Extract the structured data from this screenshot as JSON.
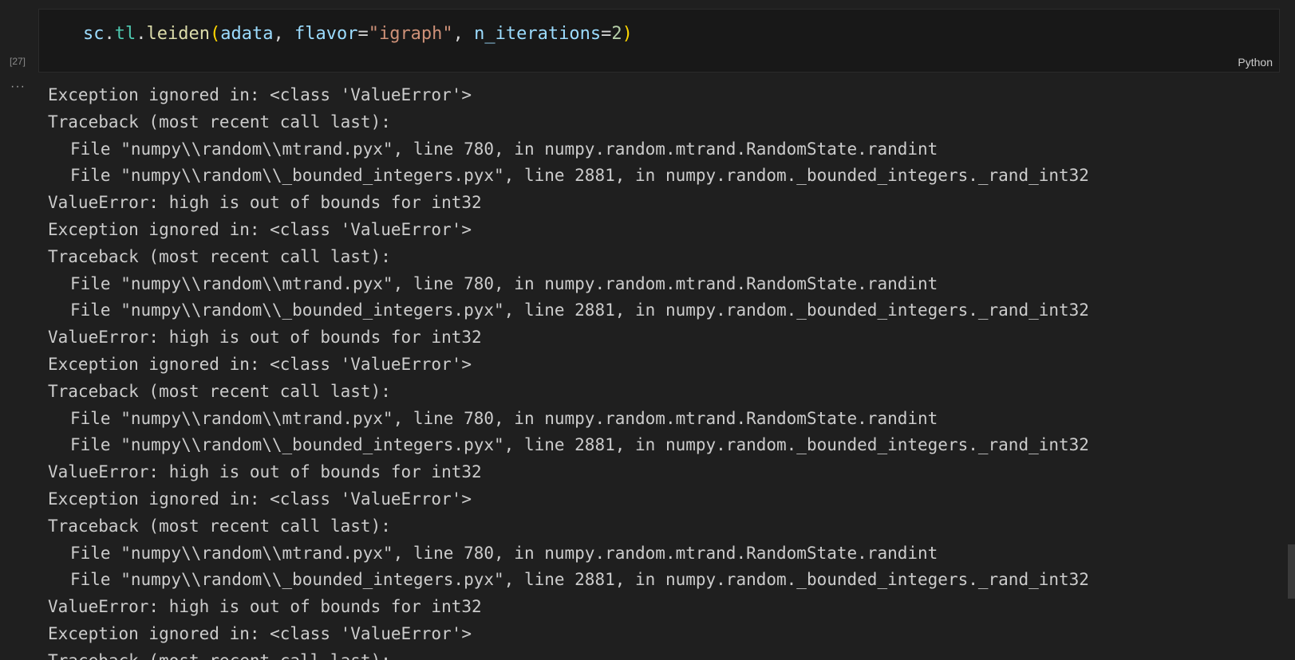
{
  "cell": {
    "execution_count": "[27]",
    "language": "Python",
    "code": {
      "t1": "sc",
      "t2": ".",
      "t3": "tl",
      "t4": ".",
      "t5": "leiden",
      "t6": "(",
      "t7": "adata",
      "t8": ", ",
      "t9": "flavor",
      "t10": "=",
      "t11": "\"igraph\"",
      "t12": ", ",
      "t13": "n_iterations",
      "t14": "=",
      "t15": "2",
      "t16": ")"
    }
  },
  "output": {
    "toggle": "···",
    "lines": [
      "Exception ignored in: <class 'ValueError'>",
      "Traceback (most recent call last):",
      "File \"numpy\\\\random\\\\mtrand.pyx\", line 780, in numpy.random.mtrand.RandomState.randint",
      "File \"numpy\\\\random\\\\_bounded_integers.pyx\", line 2881, in numpy.random._bounded_integers._rand_int32",
      "ValueError: high is out of bounds for int32",
      "Exception ignored in: <class 'ValueError'>",
      "Traceback (most recent call last):",
      "File \"numpy\\\\random\\\\mtrand.pyx\", line 780, in numpy.random.mtrand.RandomState.randint",
      "File \"numpy\\\\random\\\\_bounded_integers.pyx\", line 2881, in numpy.random._bounded_integers._rand_int32",
      "ValueError: high is out of bounds for int32",
      "Exception ignored in: <class 'ValueError'>",
      "Traceback (most recent call last):",
      "File \"numpy\\\\random\\\\mtrand.pyx\", line 780, in numpy.random.mtrand.RandomState.randint",
      "File \"numpy\\\\random\\\\_bounded_integers.pyx\", line 2881, in numpy.random._bounded_integers._rand_int32",
      "ValueError: high is out of bounds for int32",
      "Exception ignored in: <class 'ValueError'>",
      "Traceback (most recent call last):",
      "File \"numpy\\\\random\\\\mtrand.pyx\", line 780, in numpy.random.mtrand.RandomState.randint",
      "File \"numpy\\\\random\\\\_bounded_integers.pyx\", line 2881, in numpy.random._bounded_integers._rand_int32",
      "ValueError: high is out of bounds for int32",
      "Exception ignored in: <class 'ValueError'>",
      "Traceback (most recent call last):"
    ]
  }
}
